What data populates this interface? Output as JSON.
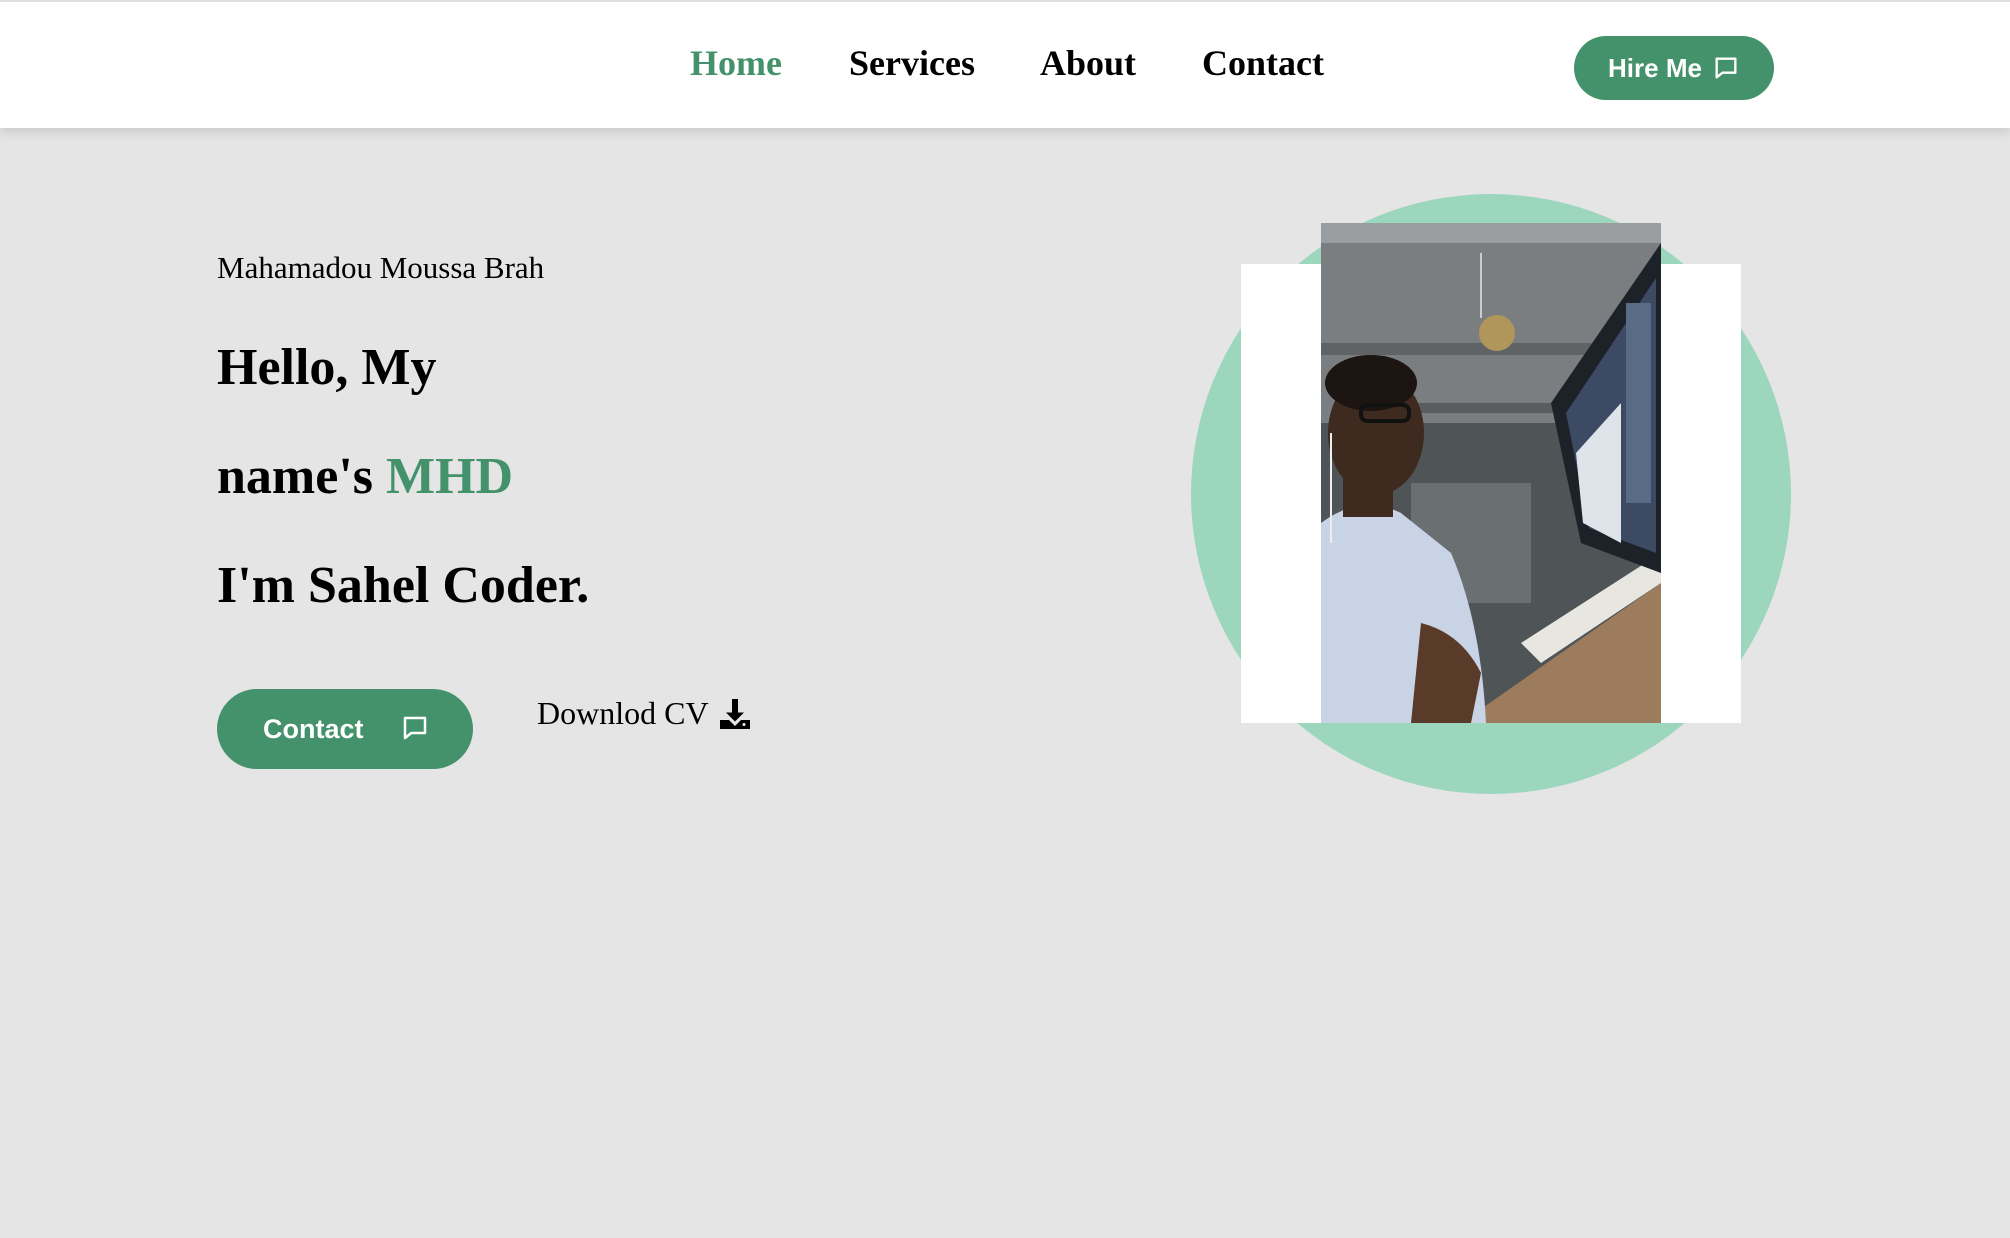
{
  "nav": {
    "items": [
      {
        "label": "Home",
        "active": true
      },
      {
        "label": "Services",
        "active": false
      },
      {
        "label": "About",
        "active": false
      },
      {
        "label": "Contact",
        "active": false
      }
    ],
    "hire_label": "Hire Me",
    "hire_icon": "chat-bubble-icon"
  },
  "hero": {
    "full_name": "Mahamadou Moussa Brah",
    "line1": "Hello, My",
    "line2_prefix": "name's ",
    "line2_highlight": "MHD",
    "line3": "I'm Sahel Coder.",
    "contact_label": "Contact",
    "contact_icon": "chat-bubble-icon",
    "download_label": "Downlod CV",
    "download_icon": "download-icon"
  },
  "colors": {
    "accent": "#44926b",
    "circle": "#9bd6bd",
    "background": "#e5e5e5"
  }
}
